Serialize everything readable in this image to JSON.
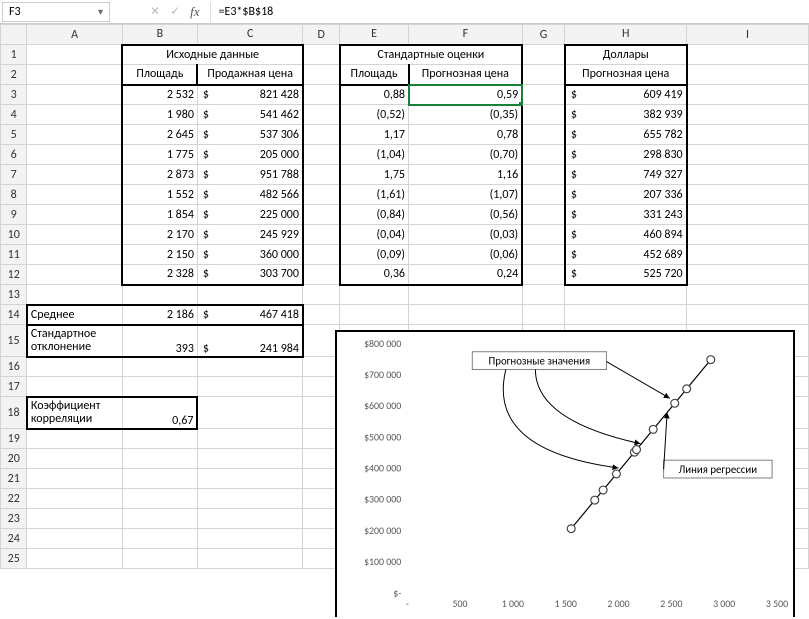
{
  "formula_bar": {
    "name_box": "F3",
    "formula": "=E3*$B$18"
  },
  "columns": [
    "A",
    "B",
    "C",
    "D",
    "E",
    "F",
    "G",
    "H",
    "I"
  ],
  "headers": {
    "src_title": "Исходные данные",
    "std_title": "Стандартные оценки",
    "dol_title": "Доллары",
    "area": "Площадь",
    "sale_price": "Продажная цена",
    "forecast_price": "Прогнозная цена"
  },
  "labels": {
    "mean": "Среднее",
    "stddev1": "Стандартное",
    "stddev2": "отклонение",
    "corr1": "Коэффициент",
    "corr2": "корреляции"
  },
  "stats": {
    "mean_area": "2 186",
    "mean_price": "467 418",
    "std_area": "393",
    "std_price": "241 984",
    "corr": "0,67"
  },
  "src_area": [
    "2 532",
    "1 980",
    "2 645",
    "1 775",
    "2 873",
    "1 552",
    "1 854",
    "2 170",
    "2 150",
    "2 328"
  ],
  "src_price": [
    "821 428",
    "541 462",
    "537 306",
    "205 000",
    "951 788",
    "482 566",
    "225 000",
    "245 929",
    "360 000",
    "303 700"
  ],
  "std_area": [
    "0,88",
    "(0,52)",
    "1,17",
    "(1,04)",
    "1,75",
    "(1,61)",
    "(0,84)",
    "(0,04)",
    "(0,09)",
    "0,36"
  ],
  "std_fore": [
    "0,59",
    "(0,35)",
    "0,78",
    "(0,70)",
    "1,16",
    "(1,07)",
    "(0,56)",
    "(0,03)",
    "(0,06)",
    "0,24"
  ],
  "dol_fore": [
    "609 419",
    "382 939",
    "655 782",
    "298 830",
    "749 327",
    "207 336",
    "331 243",
    "460 894",
    "452 689",
    "525 720"
  ],
  "chart_data": {
    "type": "scatter",
    "xlabel": "",
    "ylabel": "",
    "xlim": [
      0,
      3500
    ],
    "ylim": [
      0,
      800000
    ],
    "xticks": [
      "-",
      "500",
      "1 000",
      "1 500",
      "2 000",
      "2 500",
      "3 000",
      "3 500"
    ],
    "yticks": [
      "$-",
      "$100 000",
      "$200 000",
      "$300 000",
      "$400 000",
      "$500 000",
      "$600 000",
      "$700 000",
      "$800 000"
    ],
    "series": [
      {
        "name": "Прогнозные значения",
        "x": [
          1552,
          1775,
          1854,
          1980,
          2150,
          2170,
          2328,
          2532,
          2645,
          2873
        ],
        "y": [
          207336,
          298830,
          331243,
          382939,
          452689,
          460894,
          525720,
          609419,
          655782,
          749327
        ]
      }
    ],
    "trendline": {
      "name": "Линия регрессии",
      "x": [
        1552,
        2873
      ],
      "y": [
        207336,
        749327
      ]
    },
    "annotations": [
      {
        "text": "Прогнозные значения"
      },
      {
        "text": "Линия регрессии"
      }
    ]
  }
}
